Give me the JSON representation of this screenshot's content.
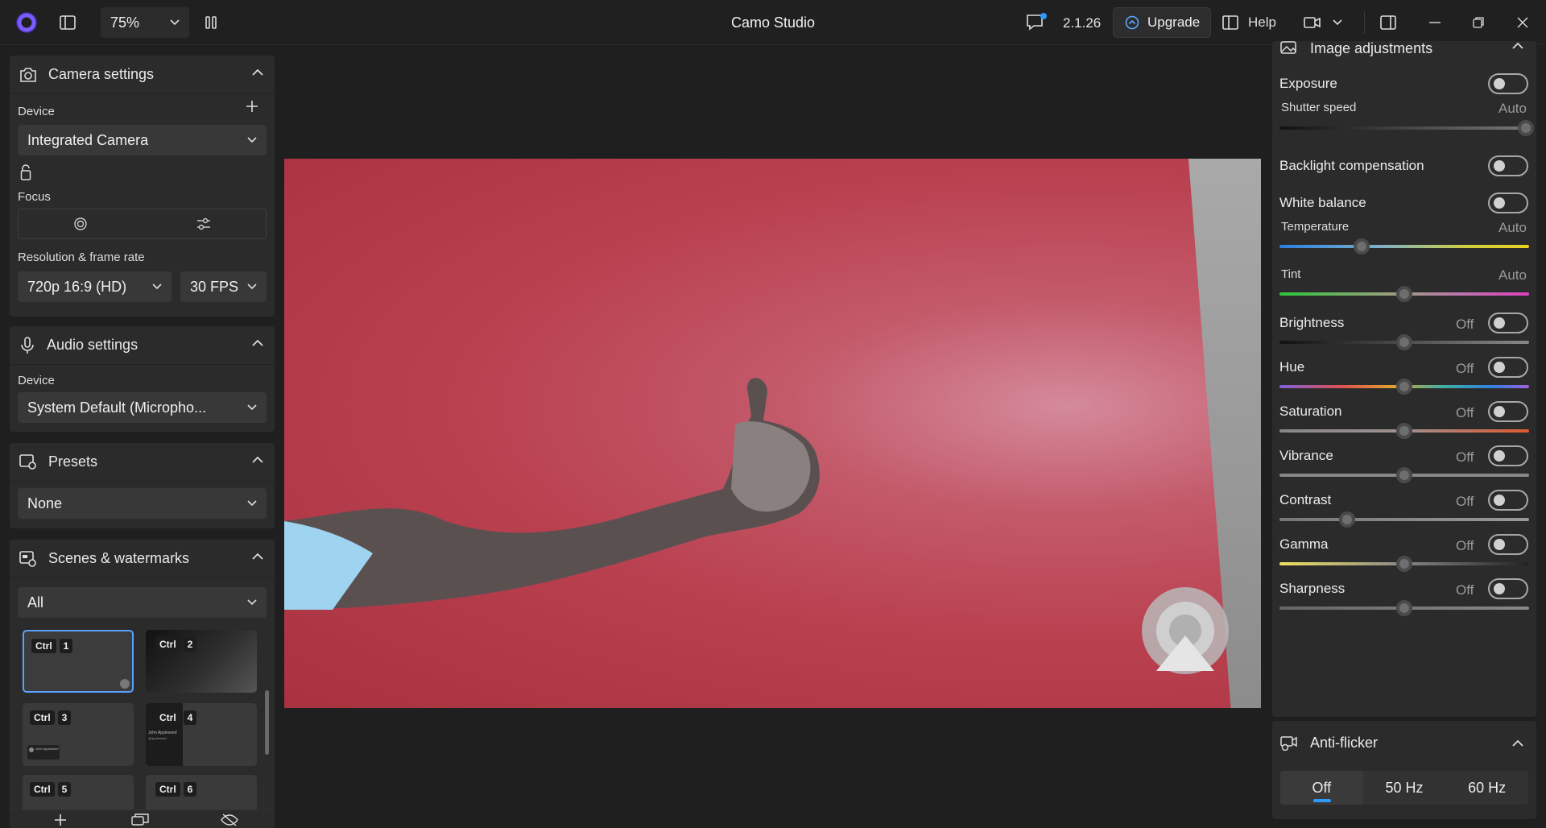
{
  "titlebar": {
    "zoom": "75%",
    "title": "Camo Studio",
    "version": "2.1.26",
    "upgrade_label": "Upgrade",
    "help_label": "Help"
  },
  "camera": {
    "title": "Camera settings",
    "device_label": "Device",
    "device_value": "Integrated Camera",
    "focus_label": "Focus",
    "resolution_label": "Resolution & frame rate",
    "resolution_value": "720p 16:9 (HD)",
    "fps_value": "30 FPS"
  },
  "audio": {
    "title": "Audio settings",
    "device_label": "Device",
    "device_value": "System Default (Micropho..."
  },
  "presets": {
    "title": "Presets",
    "value": "None"
  },
  "scenes": {
    "title": "Scenes & watermarks",
    "filter": "All",
    "cards": [
      {
        "mod": "Ctrl",
        "key": "1"
      },
      {
        "mod": "Ctrl",
        "key": "2"
      },
      {
        "mod": "Ctrl",
        "key": "3"
      },
      {
        "mod": "Ctrl",
        "key": "4"
      },
      {
        "mod": "Ctrl",
        "key": "5"
      },
      {
        "mod": "Ctrl",
        "key": "6"
      }
    ],
    "card3_caption": "John Appleseed",
    "card4_caption_1": "John Appleseed",
    "card4_caption_2": "@appleseed"
  },
  "image_adjustments": {
    "title": "Image adjustments",
    "exposure": "Exposure",
    "shutter_speed": "Shutter speed",
    "shutter_auto": "Auto",
    "shutter_level": 1.0,
    "backlight": "Backlight compensation",
    "white_balance": "White balance",
    "temperature": "Temperature",
    "temperature_auto": "Auto",
    "temperature_level": 0.33,
    "tint": "Tint",
    "tint_auto": "Auto",
    "tint_level": 0.5,
    "rows": [
      {
        "label": "Brightness",
        "state": "Off",
        "level": 0.5
      },
      {
        "label": "Hue",
        "state": "Off",
        "level": 0.5
      },
      {
        "label": "Saturation",
        "state": "Off",
        "level": 0.5
      },
      {
        "label": "Vibrance",
        "state": "Off",
        "level": 0.5
      },
      {
        "label": "Contrast",
        "state": "Off",
        "level": 0.27
      },
      {
        "label": "Gamma",
        "state": "Off",
        "level": 0.5
      },
      {
        "label": "Sharpness",
        "state": "Off",
        "level": 0.5
      }
    ]
  },
  "anti_flicker": {
    "title": "Anti-flicker",
    "options": [
      "Off",
      "50 Hz",
      "60 Hz"
    ],
    "selected": "Off"
  },
  "colors": {
    "accent": "#2f9bff",
    "selected_border": "#5aa0ff",
    "panel": "#2b2b2b",
    "background": "#1f1f1f"
  }
}
